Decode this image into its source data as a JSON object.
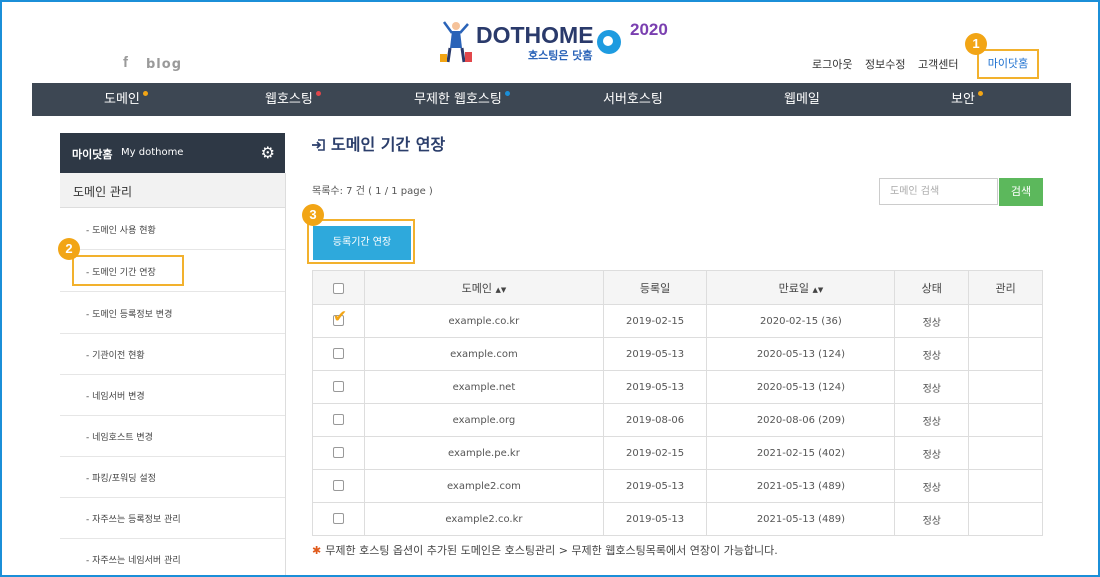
{
  "header": {
    "facebook_icon": "f",
    "blog": "blog",
    "logo_title": "DOTHOME",
    "logo_year": "2020",
    "logo_sub": "호스팅은 닷홈",
    "links": [
      "로그아웃",
      "정보수정",
      "고객센터"
    ],
    "myhome": "마이닷홈"
  },
  "badges": [
    "1",
    "2",
    "3"
  ],
  "nav": {
    "items": [
      {
        "label": "도메인",
        "dot": "#f2a515"
      },
      {
        "label": "웹호스팅",
        "dot": "#e2474b"
      },
      {
        "label": "무제한 웹호스팅",
        "dot": "#1b8fd8"
      },
      {
        "label": "서버호스팅",
        "dot": ""
      },
      {
        "label": "웹메일",
        "dot": ""
      },
      {
        "label": "보안",
        "dot": "#f2a515"
      }
    ]
  },
  "sidebar": {
    "title": "마이닷홈",
    "subtitle": "My dothome",
    "category": "도메인 관리",
    "items": [
      "- 도메인 사용 현황",
      "- 도메인 기간 연장",
      "- 도메인 등록정보 변경",
      "- 기관이전 현황",
      "- 네임서버 변경",
      "- 네임호스트 변경",
      "- 파킹/포워딩 설정",
      "- 자주쓰는 등록정보 관리",
      "- 자주쓰는 네임서버 관리"
    ]
  },
  "main": {
    "title": "도메인 기간 연장",
    "count": "목록수: 7 건 ( 1 / 1 page )",
    "search_placeholder": "도메인 검색",
    "search_button": "검색",
    "extend_button": "등록기간 연장",
    "columns": [
      "도메인",
      "등록일",
      "만료일",
      "상태",
      "관리"
    ],
    "sort_icon": "▲▼",
    "rows": [
      {
        "domain": "example.co.kr",
        "registered": "2019-02-15",
        "expires": "2020-02-15 (36)",
        "status": "정상",
        "checked": true
      },
      {
        "domain": "example.com",
        "registered": "2019-05-13",
        "expires": "2020-05-13 (124)",
        "status": "정상",
        "checked": false
      },
      {
        "domain": "example.net",
        "registered": "2019-05-13",
        "expires": "2020-05-13 (124)",
        "status": "정상",
        "checked": false
      },
      {
        "domain": "example.org",
        "registered": "2019-08-06",
        "expires": "2020-08-06 (209)",
        "status": "정상",
        "checked": false
      },
      {
        "domain": "example.pe.kr",
        "registered": "2019-02-15",
        "expires": "2021-02-15 (402)",
        "status": "정상",
        "checked": false
      },
      {
        "domain": "example2.com",
        "registered": "2019-05-13",
        "expires": "2021-05-13 (489)",
        "status": "정상",
        "checked": false
      },
      {
        "domain": "example2.co.kr",
        "registered": "2019-05-13",
        "expires": "2021-05-13 (489)",
        "status": "정상",
        "checked": false
      }
    ],
    "note": "무제한 호스팅 옵션이 추가된 도메인은 호스팅관리 > 무제한 웹호스팅목록에서 연장이 가능합니다."
  },
  "colors": {
    "accent": "#2ea9dc",
    "highlight": "#f2b12d",
    "nav_bg": "#3d4753",
    "frame": "#1b8fd8"
  }
}
